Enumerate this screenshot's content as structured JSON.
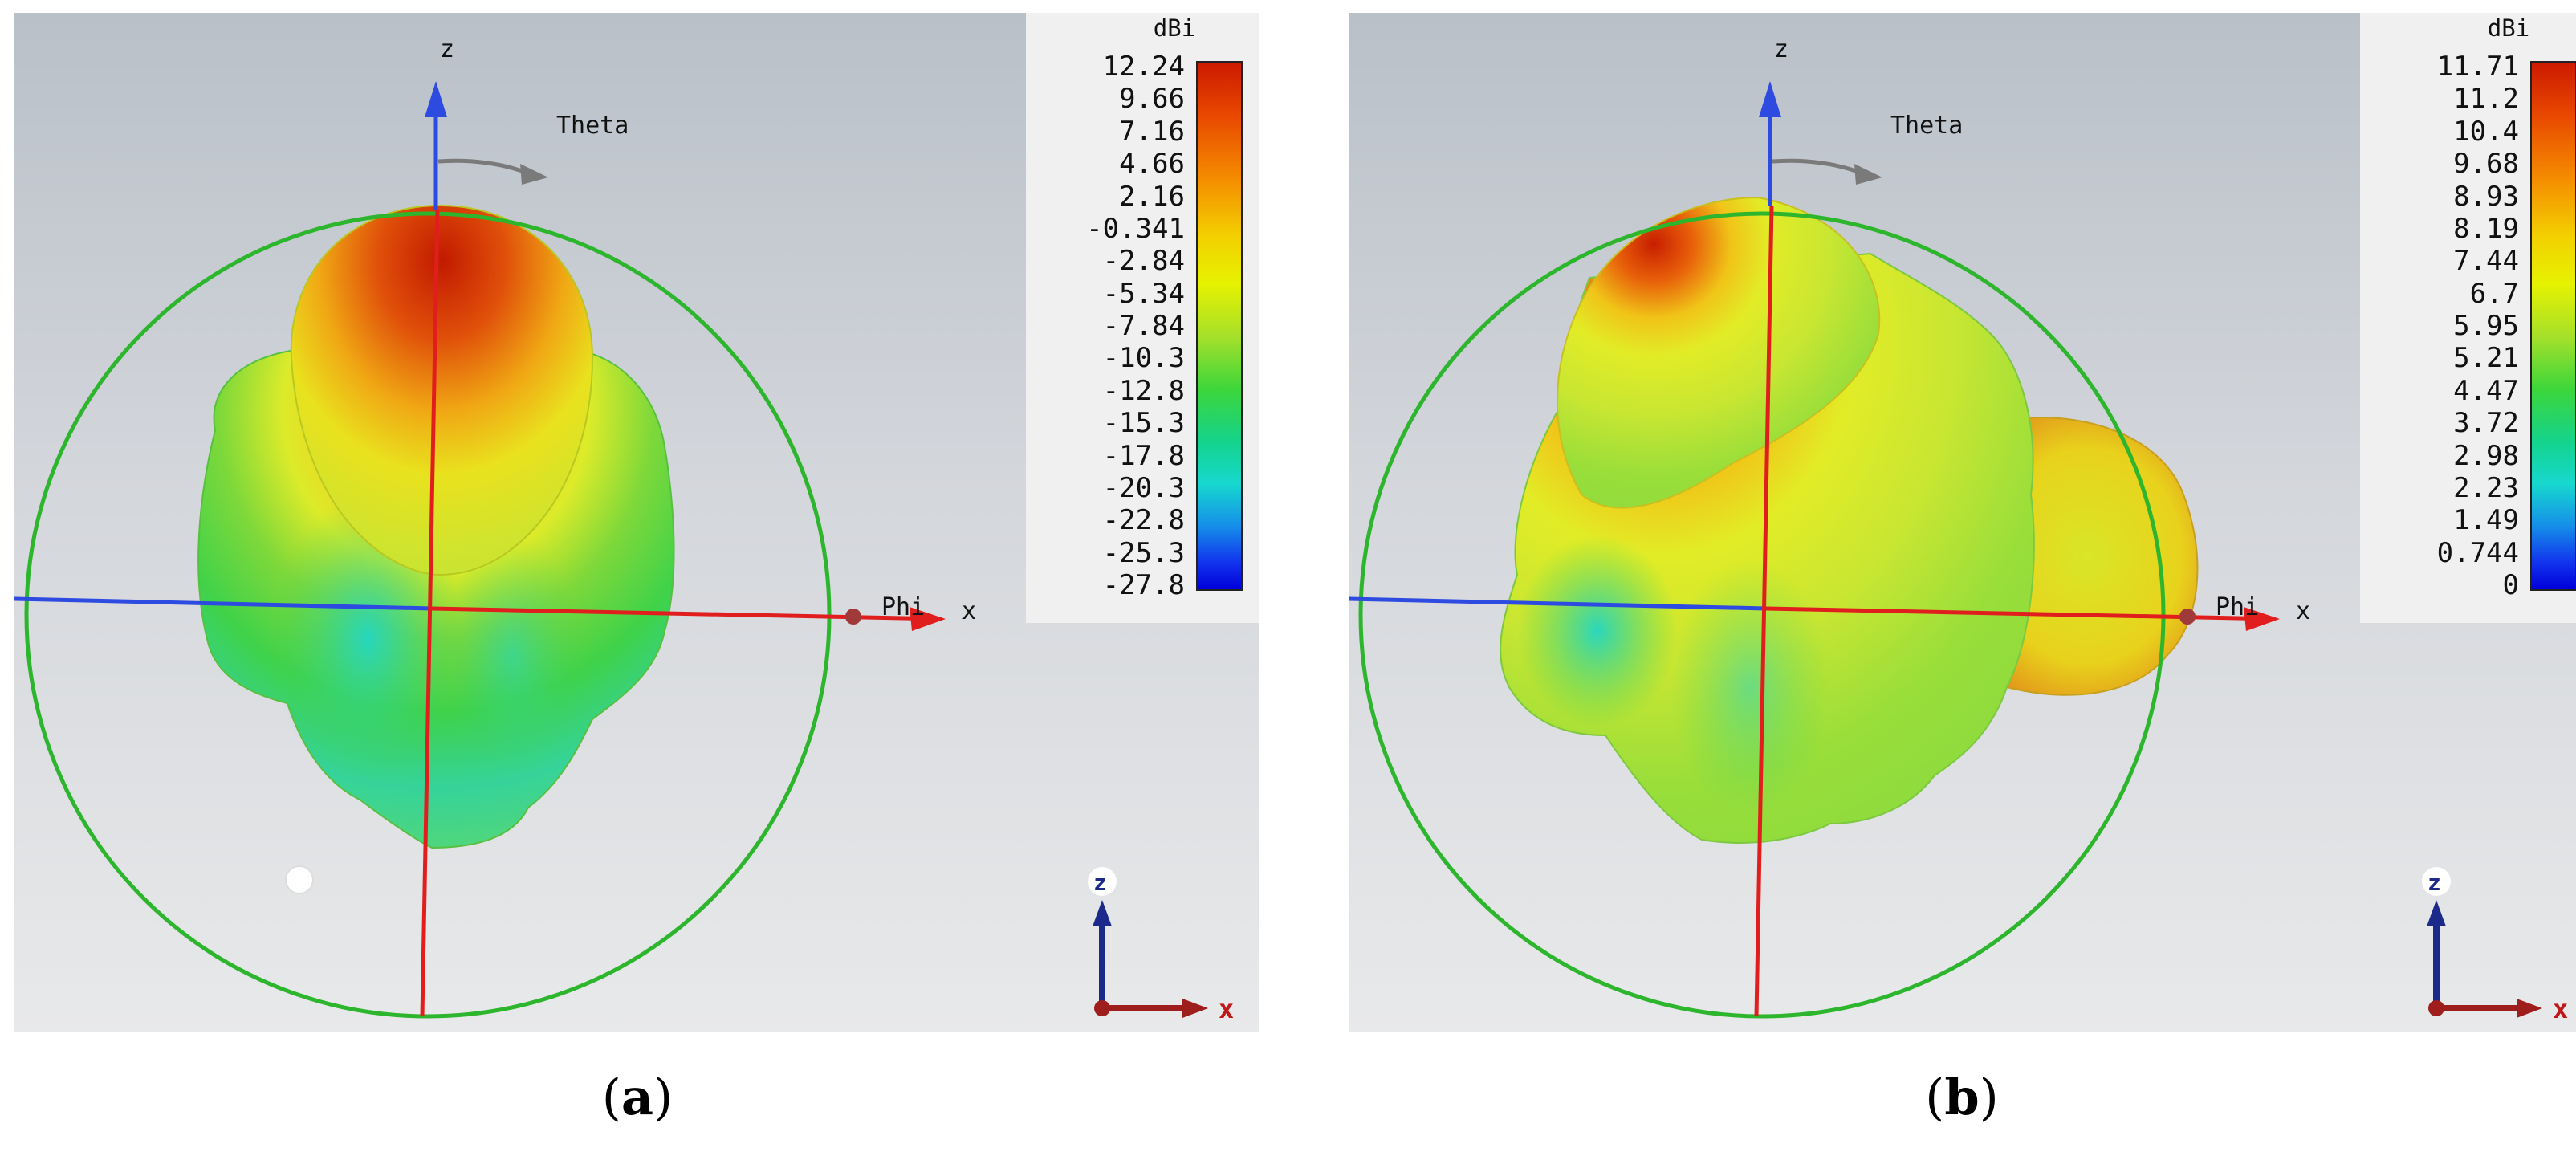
{
  "panels": [
    {
      "caption_open": "(",
      "caption_letter": "a",
      "caption_close": ")",
      "legend_unit": "dBi",
      "legend_ticks": [
        "12.24",
        "9.66",
        "7.16",
        "4.66",
        "2.16",
        "-0.341",
        "-2.84",
        "-5.34",
        "-7.84",
        "-10.3",
        "-12.8",
        "-15.3",
        "-17.8",
        "-20.3",
        "-22.8",
        "-25.3",
        "-27.8"
      ],
      "axis_z": "z",
      "axis_theta": "Theta",
      "axis_phi": "Phi",
      "axis_x": "x",
      "triad_z": "z",
      "triad_x": "x"
    },
    {
      "caption_open": "(",
      "caption_letter": "b",
      "caption_close": ")",
      "legend_unit": "dBi",
      "legend_ticks": [
        "11.71",
        "11.2",
        "10.4",
        "9.68",
        "8.93",
        "8.19",
        "7.44",
        "6.7",
        "5.95",
        "5.21",
        "4.47",
        "3.72",
        "2.98",
        "2.23",
        "1.49",
        "0.744",
        "0"
      ],
      "axis_z": "z",
      "axis_theta": "Theta",
      "axis_phi": "Phi",
      "axis_x": "x",
      "triad_z": "z",
      "triad_x": "x"
    }
  ],
  "colors": {
    "sphere_outline": "#2db52d",
    "z_axis": "#2d4be0",
    "x_axis": "#e01e1e",
    "theta_arrow": "#7a7a7a",
    "lobe_max": "#c81e00",
    "lobe_mid": "#e8ee20",
    "lobe_low": "#3fd23a",
    "lobe_min": "#2fd8c0"
  }
}
